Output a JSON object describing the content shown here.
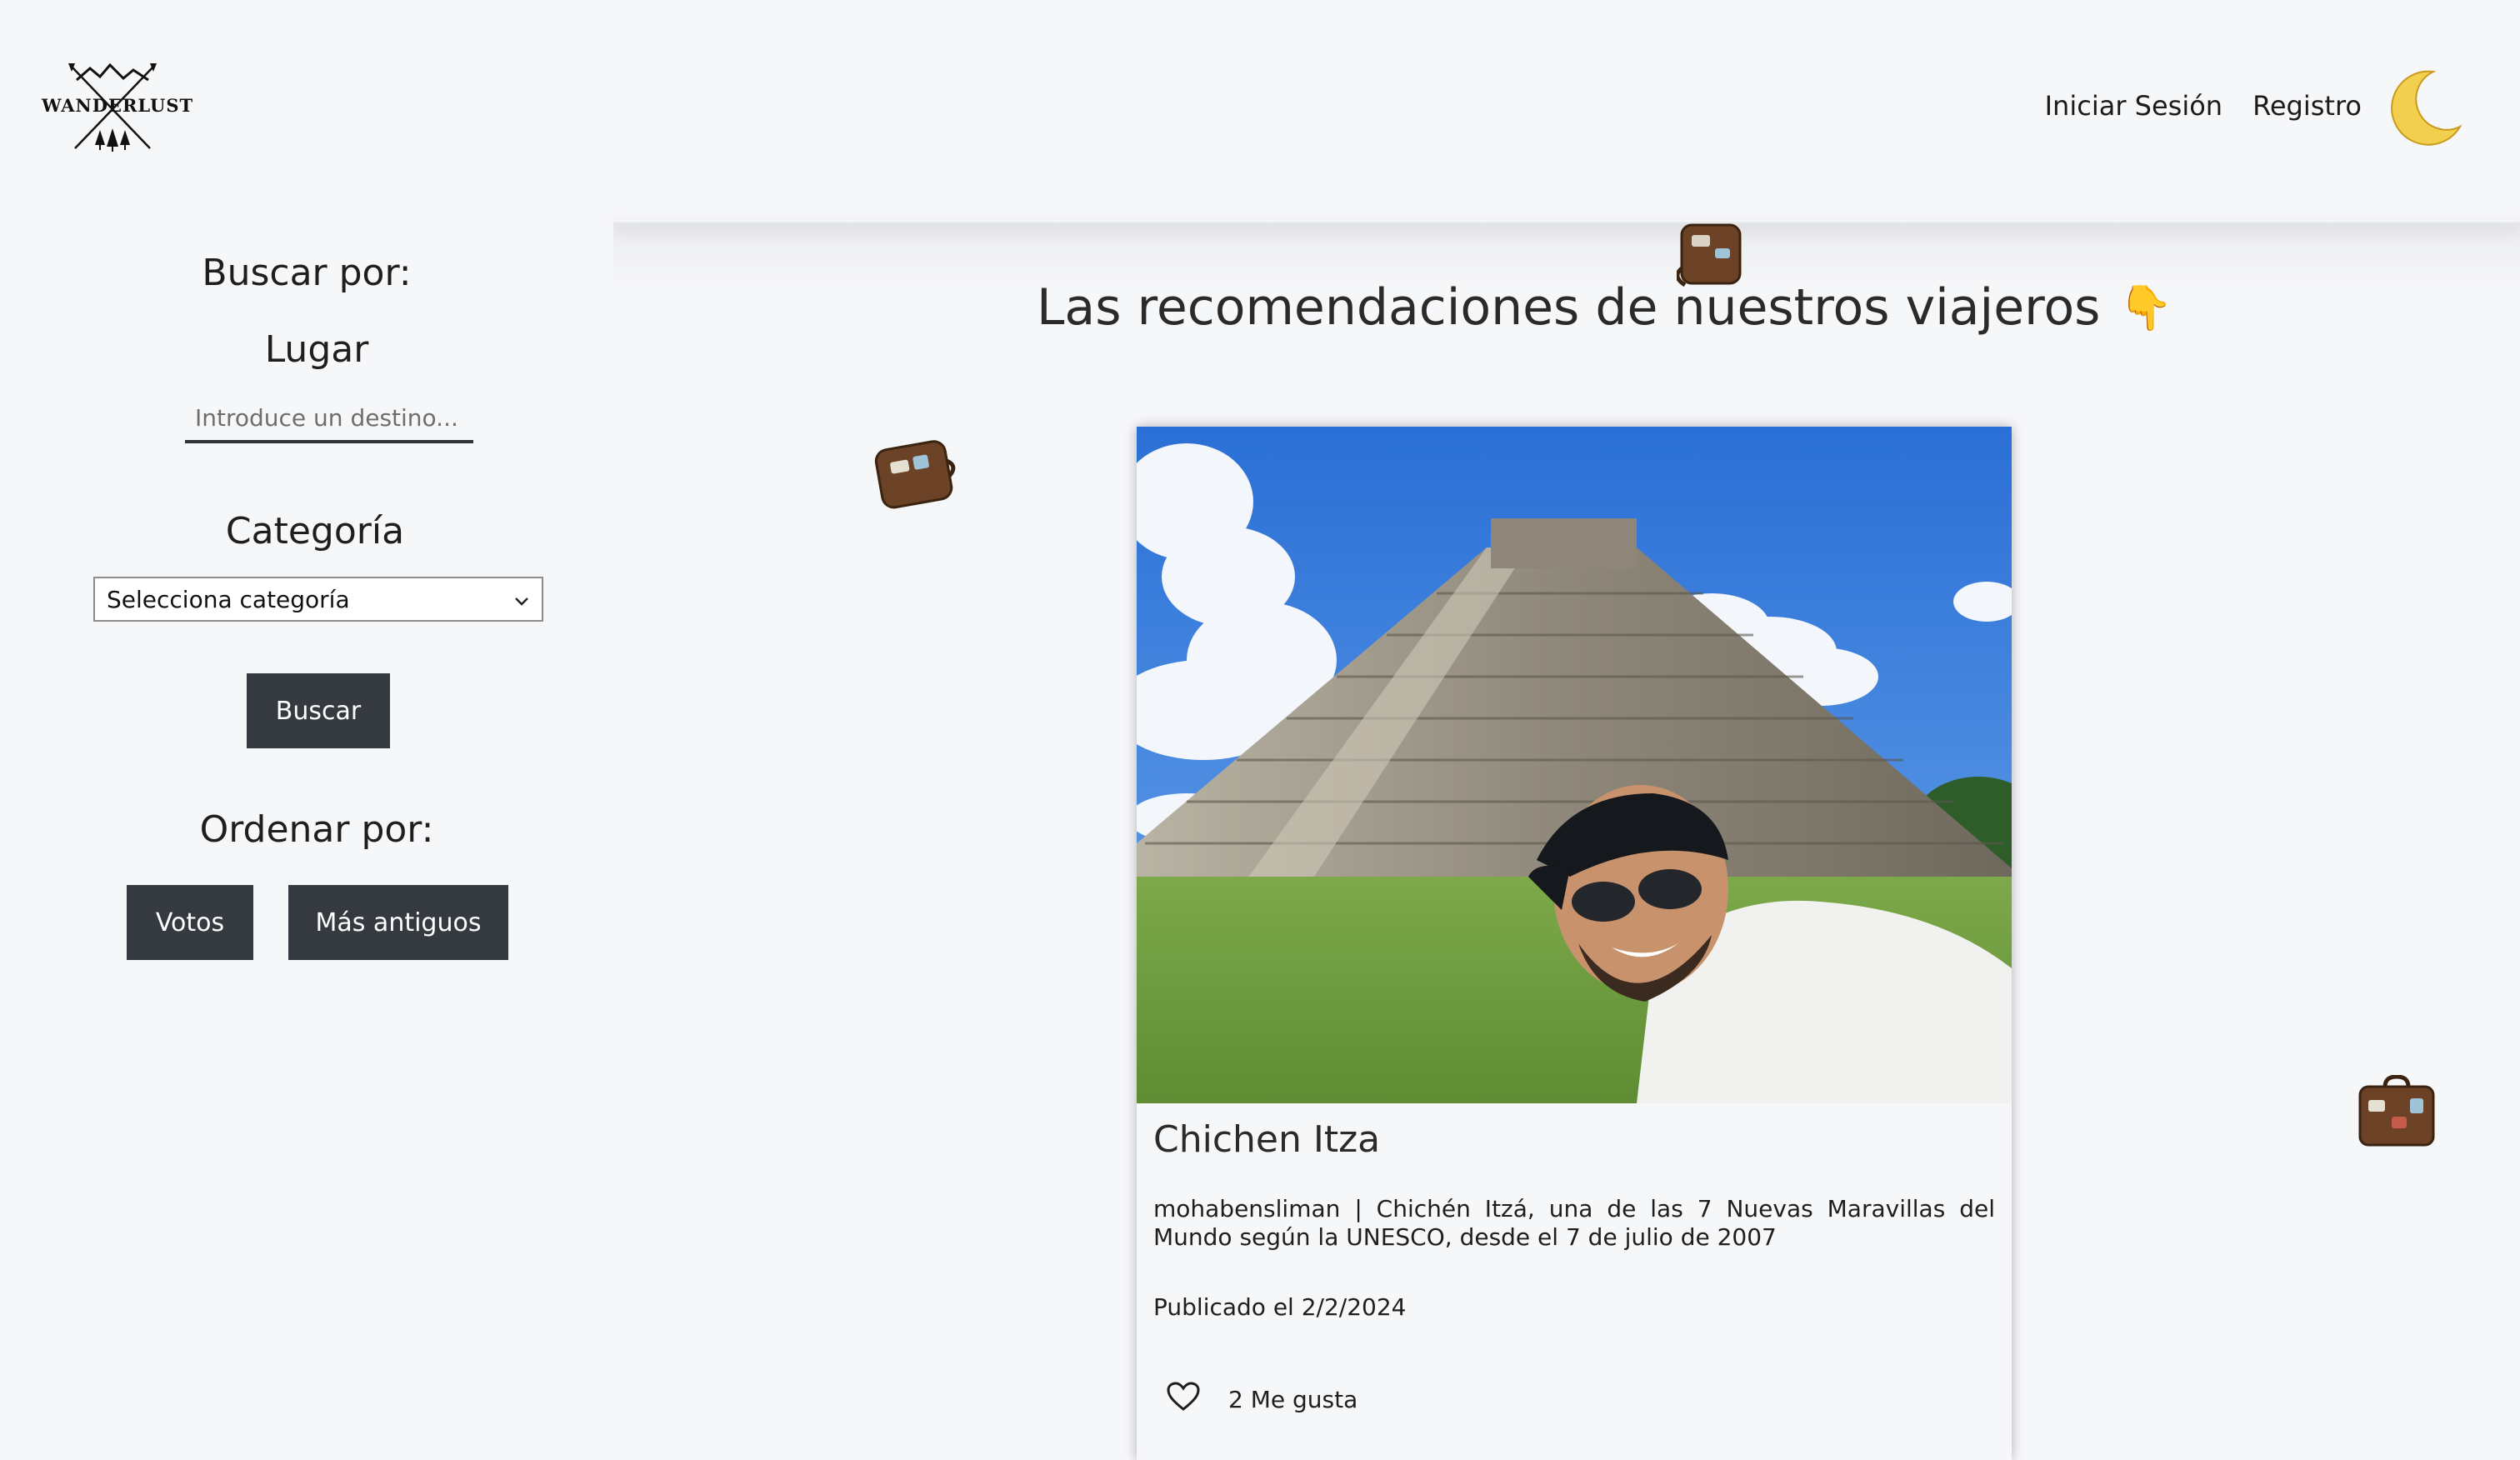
{
  "header": {
    "logo_text": "WANDERLUST",
    "nav": {
      "login": "Iniciar Sesión",
      "register": "Registro"
    },
    "theme_icon": "moon-icon"
  },
  "sidebar": {
    "search_by": "Buscar por:",
    "place_label": "Lugar",
    "place_placeholder": "Introduce un destino...",
    "category_label": "Categoría",
    "category_selected": "Selecciona categoría",
    "search_button": "Buscar",
    "sort_by": "Ordenar por:",
    "sort_votes": "Votos",
    "sort_oldest": "Más antiguos"
  },
  "main": {
    "heading": "Las recomendaciones de nuestros viajeros",
    "heading_emoji": "👇",
    "card": {
      "title": "Chichen Itza",
      "description": "mohabensliman | Chichén Itzá, una de las 7 Nuevas Maravillas del Mundo según la UNESCO, desde el 7 de julio de 2007",
      "date": "Publicado el 2/2/2024",
      "likes": "2 Me gusta",
      "like_icon": "heart-icon"
    }
  },
  "colors": {
    "button_bg": "#343a40",
    "background": "#f6f7f9",
    "moon": "#f2cf4f"
  }
}
